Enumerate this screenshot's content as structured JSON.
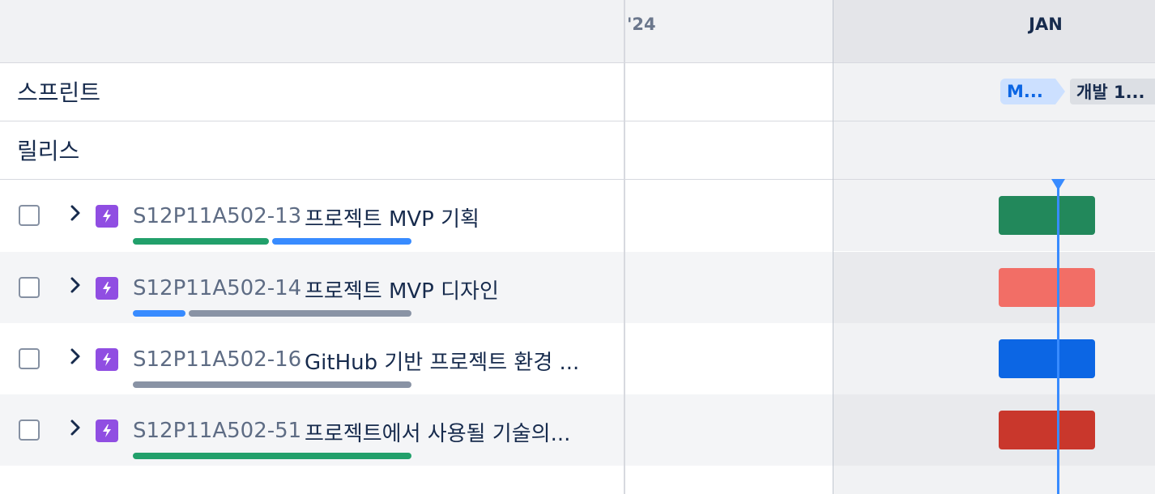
{
  "timeline": {
    "year_label": "'24",
    "month_label": "JAN"
  },
  "rows": {
    "sprints_label": "스프린트",
    "releases_label": "릴리스"
  },
  "sprints": [
    {
      "label": "M...",
      "color": "#cce0ff",
      "text_color": "#0c66e4"
    },
    {
      "label": "개발 1...",
      "color": "#dcdfe4",
      "text_color": "#172b4d"
    }
  ],
  "issues": [
    {
      "key": "S12P11A502-13",
      "title": "프로젝트 MVP 기획",
      "bar_color": "#22885b",
      "progress": {
        "done": 0.5,
        "in_progress": 0.5,
        "todo": 0.0
      }
    },
    {
      "key": "S12P11A502-14",
      "title": "프로젝트 MVP 디자인",
      "bar_color": "#f26e66",
      "progress": {
        "done": 0.0,
        "in_progress": 0.2,
        "todo": 0.8
      }
    },
    {
      "key": "S12P11A502-16",
      "title": "GitHub 기반 프로젝트 환경 ...",
      "bar_color": "#0c66e4",
      "progress": {
        "done": 0.0,
        "in_progress": 0.0,
        "todo": 1.0
      }
    },
    {
      "key": "S12P11A502-51",
      "title": "프로젝트에서 사용될 기술의...",
      "bar_color": "#c9372c",
      "progress": {
        "done": 1.0,
        "in_progress": 0.0,
        "todo": 0.0
      }
    }
  ],
  "colors": {
    "progress_done": "#22a06b",
    "progress_in_progress": "#388bff",
    "progress_todo": "#8993a5",
    "today_marker": "#388bff",
    "epic_icon": "#904ee2"
  },
  "icons": {
    "epic": "lightning-bolt-icon",
    "expand": "chevron-right-icon"
  }
}
